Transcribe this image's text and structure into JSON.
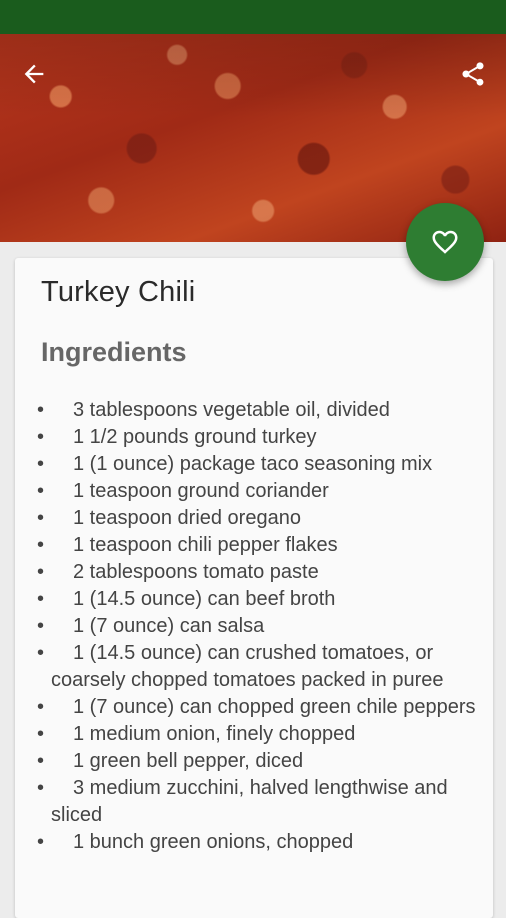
{
  "recipe": {
    "title": "Turkey Chili",
    "section_heading": "Ingredients",
    "bullet": "•",
    "ingredients": [
      "3 tablespoons vegetable oil, divided",
      "1 1/2 pounds ground turkey",
      "1 (1 ounce) package taco seasoning mix",
      "1 teaspoon ground coriander",
      "1 teaspoon dried oregano",
      "1 teaspoon chili pepper flakes",
      "2 tablespoons tomato paste",
      "1 (14.5 ounce) can beef broth",
      "1 (7 ounce) can salsa",
      "1 (14.5 ounce) can crushed tomatoes, or coarsely chopped tomatoes packed in puree",
      "1 (7 ounce) can chopped green chile peppers",
      "1 medium onion, finely chopped",
      "1 green bell pepper, diced",
      "3 medium zucchini, halved lengthwise and sliced",
      "1 bunch green onions, chopped"
    ]
  },
  "icons": {
    "back": "back-arrow-icon",
    "share": "share-icon",
    "favorite": "heart-outline-icon"
  },
  "colors": {
    "status_bar": "#1a5c1d",
    "fab": "#2e7d32",
    "card": "#fafafa",
    "background": "#ececec"
  }
}
